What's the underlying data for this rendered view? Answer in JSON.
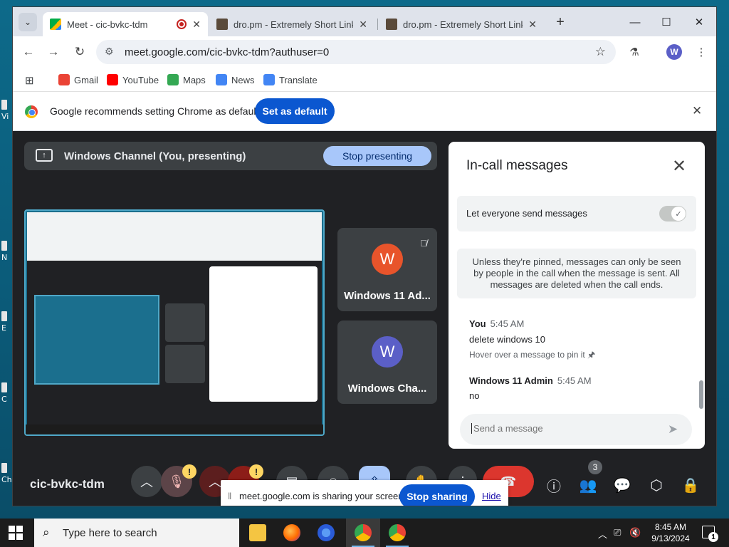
{
  "desktop": {
    "icon_letters": [
      "Vi",
      "N",
      "E",
      "C",
      "Ch"
    ]
  },
  "tabs": [
    {
      "title": "Meet - cic-bvkc-tdm",
      "favicon_color": "#00897b",
      "active": true,
      "recording": true
    },
    {
      "title": "dro.pm - Extremely Short Links",
      "favicon_color": "#5a4a3a",
      "active": false
    },
    {
      "title": "dro.pm - Extremely Short Links",
      "favicon_color": "#5a4a3a",
      "active": false
    }
  ],
  "window_controls": {
    "minimize": "—",
    "maximize": "☐",
    "close": "✕"
  },
  "toolbar": {
    "url": "meet.google.com/cic-bvkc-tdm?authuser=0",
    "avatar_letter": "W"
  },
  "bookmarks": [
    {
      "label": "Gmail",
      "color": "#ea4335"
    },
    {
      "label": "YouTube",
      "color": "#ff0000"
    },
    {
      "label": "Maps",
      "color": "#34a853"
    },
    {
      "label": "News",
      "color": "#4285f4"
    },
    {
      "label": "Translate",
      "color": "#4285f4"
    }
  ],
  "infobar": {
    "message": "Google recommends setting Chrome as default",
    "button": "Set as default"
  },
  "meet": {
    "presenting_label": "Windows Channel (You, presenting)",
    "stop_presenting": "Stop presenting",
    "participants": [
      {
        "initial": "W",
        "name": "Windows 11 Ad...",
        "color": "#e8542b",
        "muted": true
      },
      {
        "initial": "W",
        "name": "Windows Cha...",
        "color": "#5b5fc7",
        "muted": false
      }
    ],
    "meeting_code": "cic-bvkc-tdm",
    "people_count": "3",
    "warning_mark": "!"
  },
  "chat": {
    "title": "In-call messages",
    "toggle_label": "Let everyone send messages",
    "notice": "Unless they're pinned, messages can only be seen by people in the call when the message is sent. All messages are deleted when the call ends.",
    "messages": [
      {
        "sender": "You",
        "time": "5:45 AM",
        "text": "delete windows 10",
        "hint": "Hover over a message to pin it 🖈"
      },
      {
        "sender": "Windows 11 Admin",
        "time": "5:45 AM",
        "text": "no"
      }
    ],
    "input_placeholder": "Send a message"
  },
  "share_bar": {
    "message": "meet.google.com is sharing your screen.",
    "stop_button": "Stop sharing",
    "hide_link": "Hide"
  },
  "taskbar": {
    "search_placeholder": "Type here to search",
    "time": "8:45 AM",
    "date": "9/13/2024",
    "notification_count": "1"
  }
}
